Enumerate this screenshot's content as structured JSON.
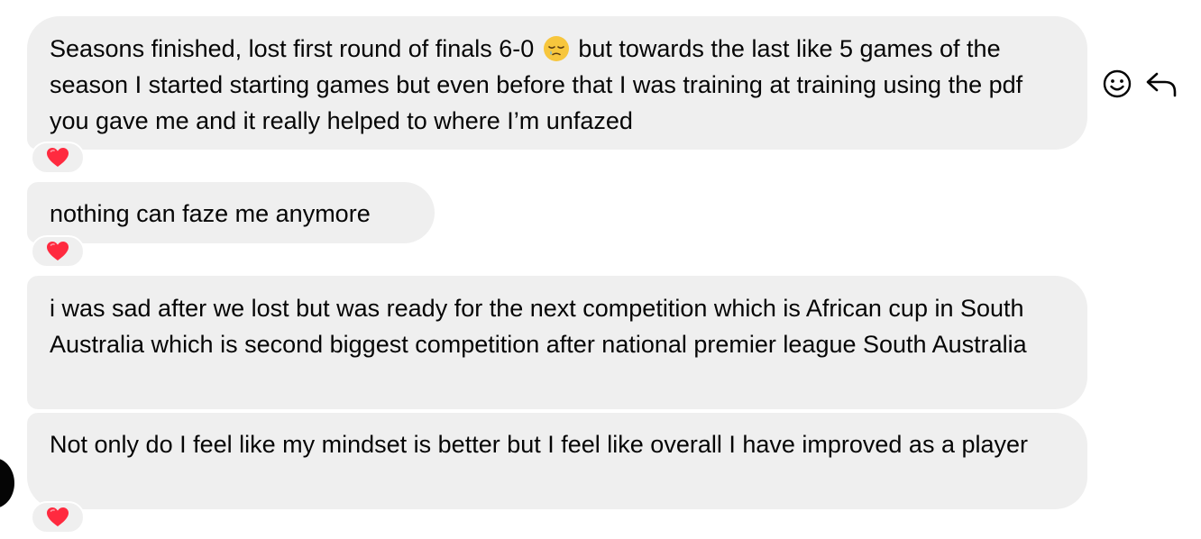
{
  "messages": [
    {
      "text_before_emoji": "Seasons finished, lost first round of finals 6-0",
      "inline_emoji": "sleepy-face-emoji",
      "text_after_emoji": "but towards the last like 5 games of the season I started starting games but even before that I was training at training using the pdf you gave me and it really helped to where I’m unfazed",
      "reaction": "red-heart-emoji"
    },
    {
      "text": "nothing can faze me anymore",
      "reaction": "red-heart-emoji"
    },
    {
      "text": "i was sad after we lost but was ready for the next competition which is African cup in South Australia which is second biggest competition after national premier league South Australia"
    },
    {
      "text": "Not only do I feel like my mindset is better but I feel like overall I have improved as a player",
      "reaction": "red-heart-emoji"
    }
  ],
  "actions": {
    "react_icon": "smiley-face-icon",
    "reply_icon": "reply-arrow-icon"
  },
  "colors": {
    "bubble": "#efefef",
    "text": "#050505",
    "heart": "#ff2a3f",
    "background": "#ffffff"
  }
}
